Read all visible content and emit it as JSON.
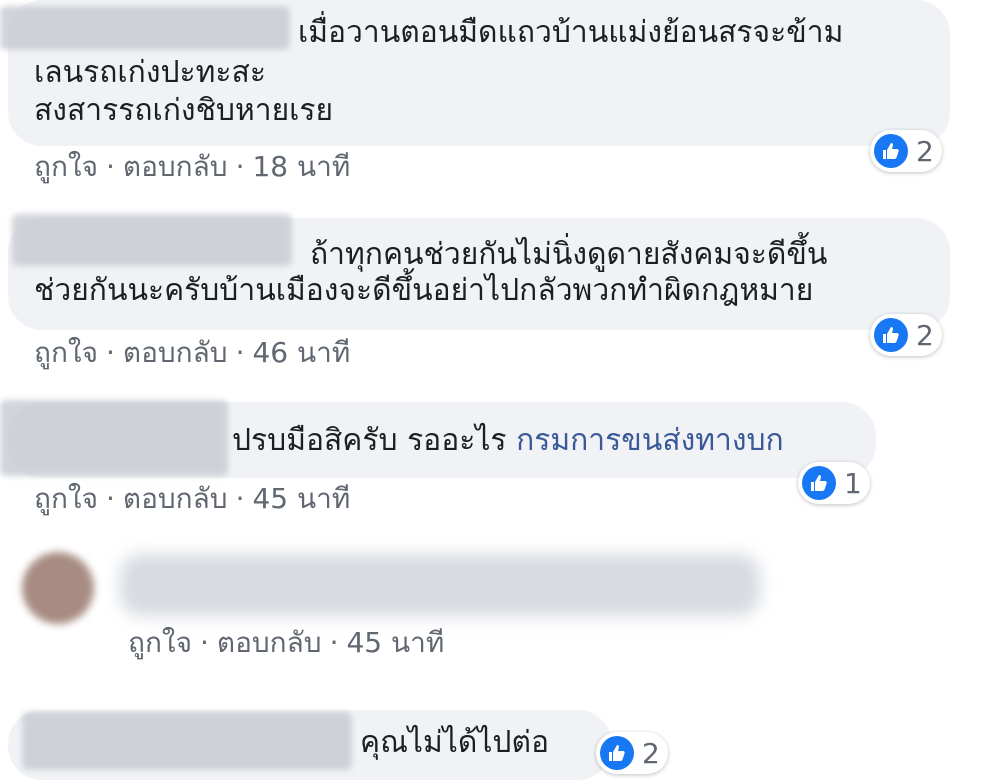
{
  "comments": [
    {
      "lines": [
        "เมื่อวานตอนมืดแถวบ้านแม่งย้อนสรจะข้าม",
        "เลนรถเก่งปะทะสะ",
        "สงสารรถเก่งชิบหายเรย"
      ],
      "like": "ถูกใจ",
      "reply": "ตอบกลับ",
      "time": "18 นาที",
      "reactions": "2"
    },
    {
      "lines": [
        "ถ้าทุกคนช่วยกันไม่นิ่งดูดายสังคมจะดีขึ้น",
        "ช่วยกันนะครับบ้านเมืองจะดีขึ้นอย่าไปกลัวพวกทำผิดกฎหมาย"
      ],
      "like": "ถูกใจ",
      "reply": "ตอบกลับ",
      "time": "46 นาที",
      "reactions": "2"
    },
    {
      "text": "ปรบมือสิครับ รออะไร",
      "mention": "กรมการขนส่งทางบก",
      "like": "ถูกใจ",
      "reply": "ตอบกลับ",
      "time": "45 นาที",
      "reactions": "1"
    },
    {
      "like": "ถูกใจ",
      "reply": "ตอบกลับ",
      "time": "45 นาที"
    },
    {
      "text": "คุณไม่ได้ไปต่อ",
      "reactions": "2"
    }
  ],
  "colors": {
    "bubble": "#f0f2f5",
    "like_blue": "#1877f2",
    "meta": "#606770",
    "link": "#385898"
  },
  "icons": {
    "reaction": "thumbs-up-icon"
  }
}
